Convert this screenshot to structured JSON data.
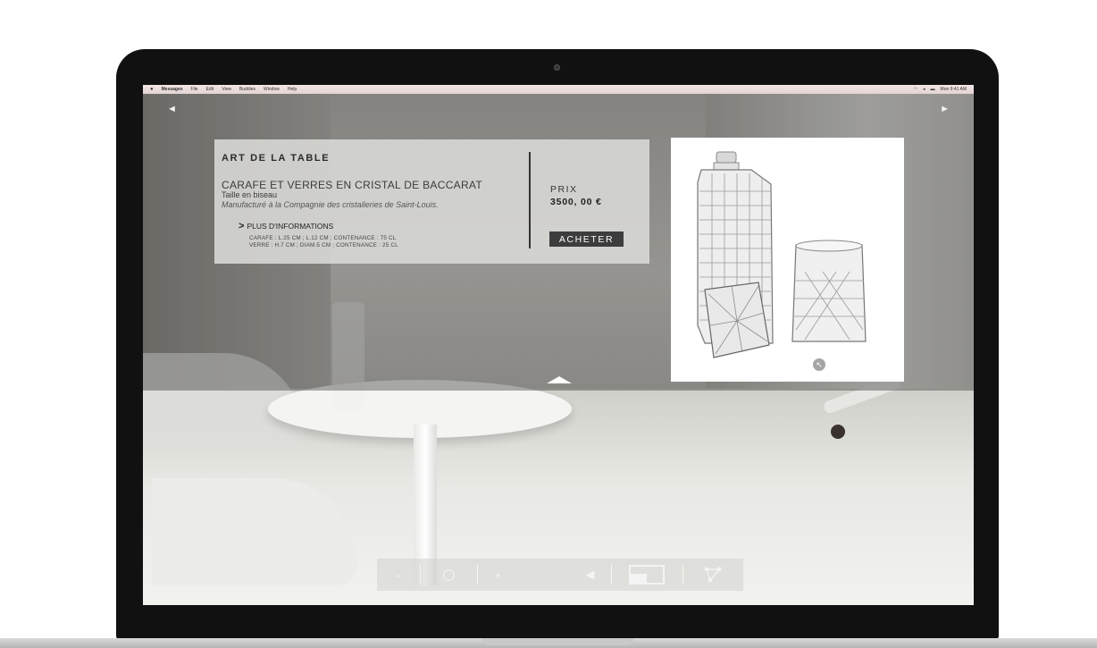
{
  "menubar": {
    "apple_icon": "apple-icon",
    "app_name": "Messages",
    "items": [
      "File",
      "Edit",
      "View",
      "Buddies",
      "Window",
      "Help"
    ],
    "clock": "Mon 9:41 AM"
  },
  "nav": {
    "prev_glyph": "◄",
    "next_glyph": "►"
  },
  "product": {
    "category": "ART DE LA TABLE",
    "title": "CARAFE ET VERRES EN CRISTAL DE BACCARAT",
    "cut": "Taille en biseau",
    "maker": "Manufacturé à la Compagnie des cristalleries de Saint-Louis.",
    "more_label": "PLUS D'INFORMATIONS",
    "more_glyph": ">",
    "spec_1": "CARAFE : L.25 CM ; L.12 CM ; CONTENANCE : 75 CL",
    "spec_2": "VERRE : H.7 CM ; DIAM.5 CM ; CONTENANCE : 25 CL",
    "price_label": "PRIX",
    "price_value": "3500, 00 €",
    "buy_label": "ACHETER"
  },
  "image_panel": {
    "zoom_glyph": "↖"
  },
  "controls": {
    "minus_glyph": "-",
    "plus_glyph": "+",
    "sound_glyph": "◀"
  },
  "icons": {
    "zoom": "expand-icon",
    "sound": "speaker-icon",
    "fullscreen": "fullscreen-icon",
    "share": "share-icon"
  }
}
